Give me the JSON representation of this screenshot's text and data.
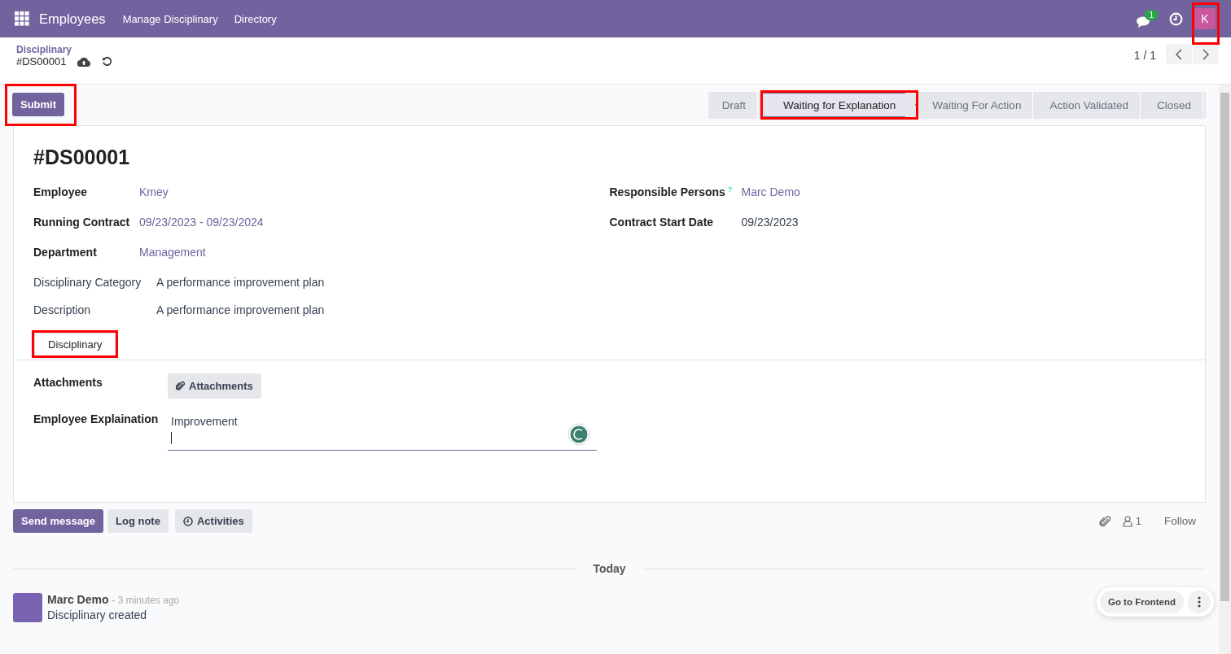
{
  "navbar": {
    "app": "Employees",
    "menus": [
      "Manage Disciplinary",
      "Directory"
    ],
    "message_count": "1",
    "avatar": {
      "initial": "K",
      "highlighted": true
    }
  },
  "breadcrumb": {
    "parent": "Disciplinary",
    "current": "#DS00001"
  },
  "pager": {
    "value": "1 / 1"
  },
  "actions": [
    {
      "label": "Submit",
      "highlighted": true
    }
  ],
  "stages": [
    {
      "label": "Draft",
      "selected": false,
      "highlighted": false
    },
    {
      "label": "Waiting for Explanation",
      "selected": true,
      "highlighted": true
    },
    {
      "label": "Waiting For Action",
      "selected": false,
      "highlighted": false
    },
    {
      "label": "Action Validated",
      "selected": false,
      "highlighted": false
    },
    {
      "label": "Closed",
      "selected": false,
      "highlighted": false
    }
  ],
  "record": {
    "title": "#DS00001",
    "left_fields": [
      {
        "label": "Employee",
        "value": "Kmey",
        "required": true,
        "kind": "link"
      },
      {
        "label": "Running Contract",
        "value": "09/23/2023 - 09/23/2024",
        "required": true,
        "kind": "link"
      },
      {
        "label": "Department",
        "value": "Management",
        "required": true,
        "kind": "link"
      }
    ],
    "right_fields": [
      {
        "label": "Responsible Persons",
        "help": "?",
        "value": "Marc Demo",
        "required": true,
        "kind": "link"
      },
      {
        "label": "Contract Start Date",
        "value": "09/23/2023",
        "required": true,
        "kind": "text"
      }
    ],
    "wide_fields": [
      {
        "label": "Disciplinary Category",
        "value": "A performance improvement plan",
        "required": false
      },
      {
        "label": "Description",
        "value": "A performance improvement plan",
        "required": false
      }
    ],
    "tabs": [
      {
        "label": "Disciplinary",
        "selected": true,
        "highlighted": true
      }
    ],
    "attachments": {
      "label": "Attachments",
      "button": "Attachments"
    },
    "explanation": {
      "label": "Employee Explaination",
      "value": "Improvement"
    }
  },
  "chatter": {
    "buttons": [
      {
        "label": "Send message",
        "kind": "primary"
      },
      {
        "label": "Log note",
        "kind": "secondary"
      },
      {
        "label": "Activities",
        "kind": "activities"
      }
    ],
    "followers": "1",
    "follow": "Follow",
    "date_separator": "Today",
    "messages": [
      {
        "author": "Marc Demo",
        "time": "- 3 minutes ago",
        "body": "Disciplinary created"
      }
    ]
  },
  "floating": {
    "button": "Go to Frontend"
  }
}
